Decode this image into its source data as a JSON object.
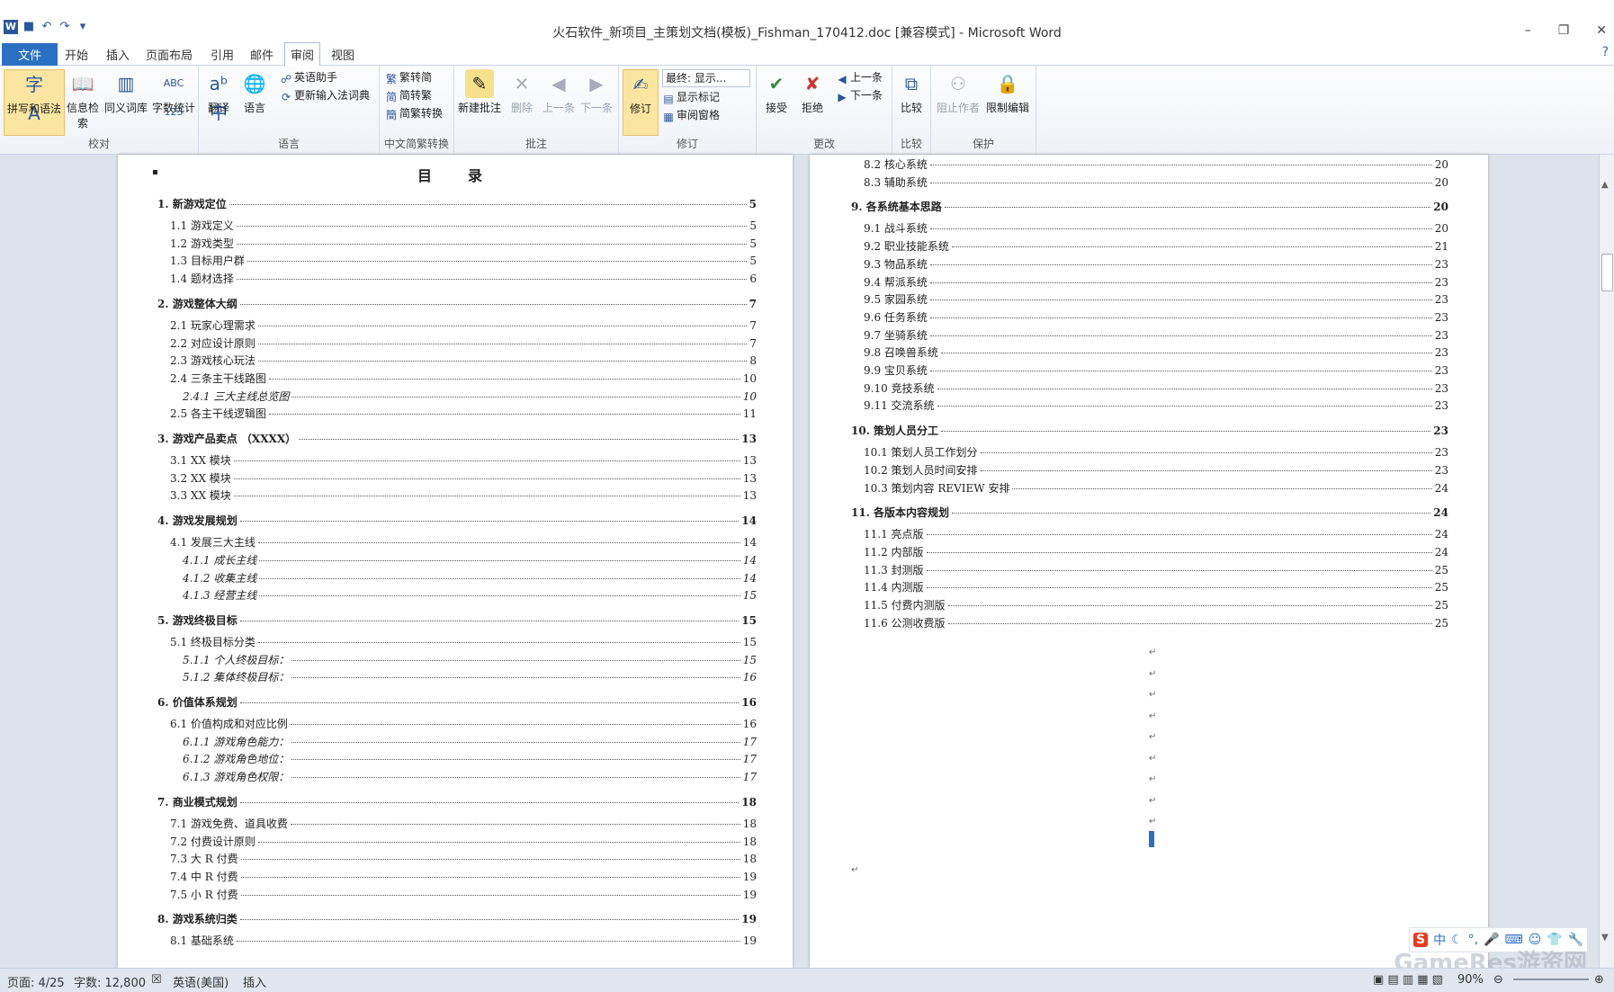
{
  "window": {
    "title": "火石软件_新项目_主策划文档(模板)_Fishman_170412.doc [兼容模式] - Microsoft Word",
    "buttons": [
      "–",
      "❐",
      "✕"
    ]
  },
  "menu": {
    "tabs": [
      "文件",
      "开始",
      "插入",
      "页面布局",
      "引用",
      "邮件",
      "审阅",
      "视图"
    ],
    "active": "审阅"
  },
  "ribbon": {
    "groups": {
      "proof": "校对",
      "language": "语言",
      "chinese": "中文简繁转换",
      "comments": "批注",
      "tracking": "修订",
      "changes": "更改",
      "compare": "比较",
      "protect": "保护"
    },
    "buttons": {
      "spelling": "拼写和语法",
      "info_search": "信息检索",
      "thesaurus": "同义词库",
      "word_count": "字数统计",
      "translate": "翻译",
      "language": "语言",
      "english_assistant": "英语助手",
      "update_ime": "更新输入法词典",
      "trad_to_simp": "繁转简",
      "simp_to_trad": "简转繁",
      "convert": "简繁转换",
      "new_comment": "新建批注",
      "delete": "删除",
      "prev": "上一条",
      "next": "下一条",
      "track": "修订",
      "final_display": "最终: 显示...",
      "show_markup": "显示标记",
      "review_pane": "审阅窗格",
      "accept": "接受",
      "reject": "拒绝",
      "change_prev": "上一条",
      "change_next": "下一条",
      "compare": "比较",
      "block_authors": "阻止作者",
      "restrict_editing": "限制编辑"
    }
  },
  "document": {
    "toc_title": "目　录",
    "left_entries": [
      {
        "level": 1,
        "text": "1.  新游戏定位",
        "page": "5"
      },
      {
        "level": 2,
        "text": "1.1  游戏定义",
        "page": "5"
      },
      {
        "level": 2,
        "text": "1.2  游戏类型",
        "page": "5"
      },
      {
        "level": 2,
        "text": "1.3  目标用户群",
        "page": "5"
      },
      {
        "level": 2,
        "text": "1.4  题材选择",
        "page": "6"
      },
      {
        "level": 1,
        "text": "2.  游戏整体大纲",
        "page": "7"
      },
      {
        "level": 2,
        "text": "2.1  玩家心理需求",
        "page": "7"
      },
      {
        "level": 2,
        "text": "2.2  对应设计原则",
        "page": "7"
      },
      {
        "level": 2,
        "text": "2.3  游戏核心玩法",
        "page": "8"
      },
      {
        "level": 2,
        "text": "2.4  三条主干线路图",
        "page": "10"
      },
      {
        "level": 3,
        "text": "2.4.1  三大主线总览图",
        "page": "10"
      },
      {
        "level": 2,
        "text": "2.5  各主干线逻辑图",
        "page": "11"
      },
      {
        "level": 1,
        "text": "3.  游戏产品卖点 （XXXX）",
        "page": "13"
      },
      {
        "level": 2,
        "text": "3.1 XX 模块",
        "page": "13"
      },
      {
        "level": 2,
        "text": "3.2 XX 模块",
        "page": "13"
      },
      {
        "level": 2,
        "text": "3.3 XX 模块",
        "page": "13"
      },
      {
        "level": 1,
        "text": "4.  游戏发展规划",
        "page": "14"
      },
      {
        "level": 2,
        "text": "4.1  发展三大主线",
        "page": "14"
      },
      {
        "level": 3,
        "text": "4.1.1  成长主线",
        "page": "14"
      },
      {
        "level": 3,
        "text": "4.1.2  收集主线",
        "page": "14"
      },
      {
        "level": 3,
        "text": "4.1.3  经营主线",
        "page": "15"
      },
      {
        "level": 1,
        "text": "5.  游戏终极目标",
        "page": "15"
      },
      {
        "level": 2,
        "text": "5.1  终极目标分类",
        "page": "15"
      },
      {
        "level": 3,
        "text": "5.1.1  个人终极目标：",
        "page": "15"
      },
      {
        "level": 3,
        "text": "5.1.2  集体终极目标：",
        "page": "16"
      },
      {
        "level": 1,
        "text": "6.  价值体系规划",
        "page": "16"
      },
      {
        "level": 2,
        "text": "6.1  价值构成和对应比例",
        "page": "16"
      },
      {
        "level": 3,
        "text": "6.1.1  游戏角色能力：",
        "page": "17"
      },
      {
        "level": 3,
        "text": "6.1.2  游戏角色地位：",
        "page": "17"
      },
      {
        "level": 3,
        "text": "6.1.3  游戏角色权限：",
        "page": "17"
      },
      {
        "level": 1,
        "text": "7.  商业模式规划",
        "page": "18"
      },
      {
        "level": 2,
        "text": "7.1  游戏免费、道具收费",
        "page": "18"
      },
      {
        "level": 2,
        "text": "7.2  付费设计原则",
        "page": "18"
      },
      {
        "level": 2,
        "text": "7.3  大 R 付费",
        "page": "18"
      },
      {
        "level": 2,
        "text": "7.4  中 R 付费",
        "page": "19"
      },
      {
        "level": 2,
        "text": "7.5  小 R 付费",
        "page": "19"
      },
      {
        "level": 1,
        "text": "8.  游戏系统归类",
        "page": "19"
      },
      {
        "level": 2,
        "text": "8.1  基础系统",
        "page": "19"
      }
    ],
    "right_entries": [
      {
        "level": 2,
        "text": "8.2  核心系统",
        "page": "20"
      },
      {
        "level": 2,
        "text": "8.3  辅助系统",
        "page": "20"
      },
      {
        "level": 1,
        "text": "9.  各系统基本思路",
        "page": "20"
      },
      {
        "level": 2,
        "text": "9.1  战斗系统",
        "page": "20"
      },
      {
        "level": 2,
        "text": "9.2  职业技能系统",
        "page": "21"
      },
      {
        "level": 2,
        "text": "9.3  物品系统",
        "page": "23"
      },
      {
        "level": 2,
        "text": "9.4  帮派系统",
        "page": "23"
      },
      {
        "level": 2,
        "text": "9.5  家园系统",
        "page": "23"
      },
      {
        "level": 2,
        "text": "9.6  任务系统",
        "page": "23"
      },
      {
        "level": 2,
        "text": "9.7  坐骑系统",
        "page": "23"
      },
      {
        "level": 2,
        "text": "9.8  召唤兽系统",
        "page": "23"
      },
      {
        "level": 2,
        "text": "9.9  宝贝系统",
        "page": "23"
      },
      {
        "level": 2,
        "text": "9.10  竞技系统",
        "page": "23"
      },
      {
        "level": 2,
        "text": "9.11  交流系统",
        "page": "23"
      },
      {
        "level": 1,
        "text": "10.  策划人员分工",
        "page": "23"
      },
      {
        "level": 2,
        "text": "10.1  策划人员工作划分",
        "page": "23"
      },
      {
        "level": 2,
        "text": "10.2  策划人员时间安排",
        "page": "23"
      },
      {
        "level": 2,
        "text": "10.3  策划内容 REVIEW 安排",
        "page": "24"
      },
      {
        "level": 1,
        "text": "11.  各版本内容规划",
        "page": "24"
      },
      {
        "level": 2,
        "text": "11.1  亮点版",
        "page": "24"
      },
      {
        "level": 2,
        "text": "11.2  内部版",
        "page": "24"
      },
      {
        "level": 2,
        "text": "11.3  封测版",
        "page": "25"
      },
      {
        "level": 2,
        "text": "11.4  内测版",
        "page": "25"
      },
      {
        "level": 2,
        "text": "11.5  付费内测版",
        "page": "25"
      },
      {
        "level": 2,
        "text": "11.6  公测收费版",
        "page": "25"
      }
    ]
  },
  "status": {
    "page": "页面: 4/25",
    "words": "字数: 12,800",
    "language": "英语(美国)",
    "mode": "插入",
    "zoom": "90%"
  },
  "ime": {
    "logo": "S",
    "mode": "中"
  },
  "watermark": "GameRes游资网"
}
